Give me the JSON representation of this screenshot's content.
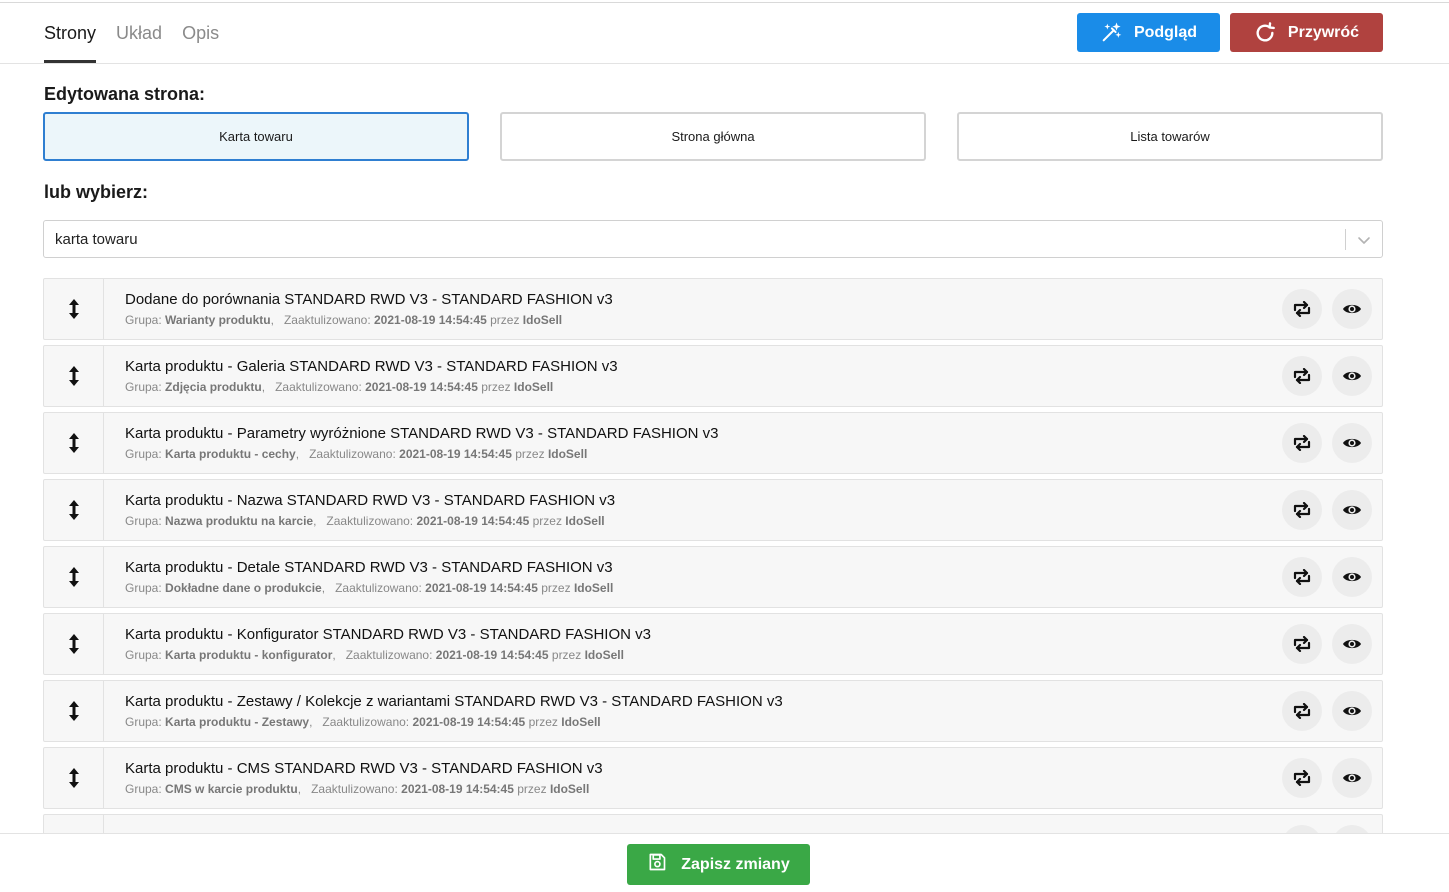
{
  "tabs": [
    {
      "label": "Strony",
      "active": true
    },
    {
      "label": "Układ",
      "active": false
    },
    {
      "label": "Opis",
      "active": false
    }
  ],
  "actions": {
    "preview_label": "Podgląd",
    "restore_label": "Przywróć",
    "save_label": "Zapisz zmiany"
  },
  "edited_page": {
    "label": "Edytowana strona:",
    "options": [
      "Karta towaru",
      "Strona główna",
      "Lista towarów"
    ],
    "selected": "Karta towaru"
  },
  "or_choose": {
    "label": "lub wybierz:",
    "value": "karta towaru"
  },
  "meta_labels": {
    "group": "Grupa:",
    "updated": "Zaaktulizowano:",
    "by": "przez"
  },
  "modules": [
    {
      "title": "Dodane do porównania STANDARD RWD V3 - STANDARD FASHION v3",
      "group": "Warianty produktu",
      "updated": "2021-08-19 14:54:45",
      "author": "IdoSell"
    },
    {
      "title": "Karta produktu - Galeria STANDARD RWD V3 - STANDARD FASHION v3",
      "group": "Zdjęcia produktu",
      "updated": "2021-08-19 14:54:45",
      "author": "IdoSell"
    },
    {
      "title": "Karta produktu - Parametry wyróżnione STANDARD RWD V3 - STANDARD FASHION v3",
      "group": "Karta produktu - cechy",
      "updated": "2021-08-19 14:54:45",
      "author": "IdoSell"
    },
    {
      "title": "Karta produktu - Nazwa STANDARD RWD V3 - STANDARD FASHION v3",
      "group": "Nazwa produktu na karcie",
      "updated": "2021-08-19 14:54:45",
      "author": "IdoSell"
    },
    {
      "title": "Karta produktu - Detale STANDARD RWD V3 - STANDARD FASHION v3",
      "group": "Dokładne dane o produkcie",
      "updated": "2021-08-19 14:54:45",
      "author": "IdoSell"
    },
    {
      "title": "Karta produktu - Konfigurator STANDARD RWD V3 - STANDARD FASHION v3",
      "group": "Karta produktu - konfigurator",
      "updated": "2021-08-19 14:54:45",
      "author": "IdoSell"
    },
    {
      "title": "Karta produktu - Zestawy / Kolekcje z wariantami STANDARD RWD V3 - STANDARD FASHION v3",
      "group": "Karta produktu - Zestawy",
      "updated": "2021-08-19 14:54:45",
      "author": "IdoSell"
    },
    {
      "title": "Karta produktu - CMS STANDARD RWD V3 - STANDARD FASHION v3",
      "group": "CMS w karcie produktu",
      "updated": "2021-08-19 14:54:45",
      "author": "IdoSell"
    }
  ],
  "icons": {
    "preview": "magic-wand-icon",
    "restore": "refresh-icon",
    "save": "save-icon",
    "drag": "drag-handle-icon",
    "sync": "sync-icon",
    "eye": "eye-icon",
    "chevron": "chevron-down-icon"
  },
  "colors": {
    "primary": "#1a8ce8",
    "danger": "#b0423f",
    "success": "#3aa846",
    "selected_border": "#2f7fd1",
    "selected_bg": "#ecf6fa"
  }
}
